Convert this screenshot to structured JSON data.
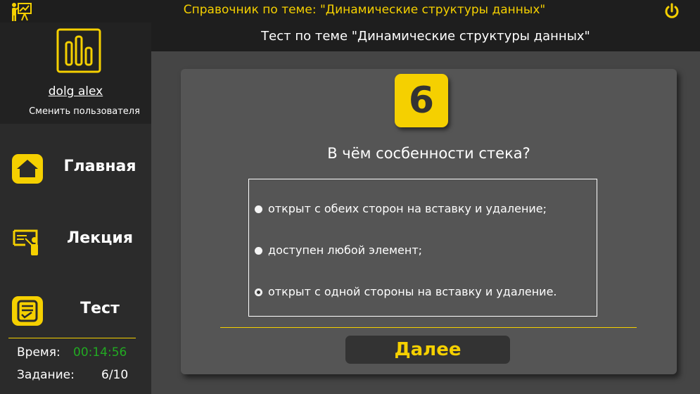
{
  "app": {
    "title": "Справочник по теме: \"Динамические структуры данных\"",
    "icon": "presentation-icon",
    "power_icon": "power-icon"
  },
  "colors": {
    "accent": "#f5d000",
    "timer": "#22aa22",
    "titlebar": "#1e1e1e",
    "sidebar": "#2b2b2b",
    "background": "#454545",
    "card": "#555555"
  },
  "sidebar": {
    "username": "dolg alex",
    "change_user": "Сменить пользователя",
    "profile_icon": "bar-chart-icon",
    "nav": [
      {
        "label": "Главная",
        "icon": "home-icon"
      },
      {
        "label": "Лекция",
        "icon": "lecture-icon"
      },
      {
        "label": "Тест",
        "icon": "test-icon"
      }
    ],
    "time_label": "Время:",
    "time_value": "00:14:56",
    "task_label": "Задание:",
    "task_value": "6/10"
  },
  "header": {
    "title": "Тест по теме \"Динамические структуры данных\""
  },
  "quiz": {
    "number": "6",
    "question": "В чём сосбенности стека?",
    "options": [
      {
        "label": "открыт с обеих сторон на вставку и удаление;",
        "selected": false
      },
      {
        "label": "доступен любой элемент;",
        "selected": false
      },
      {
        "label": "открыт с одной стороны на вставку и удаление.",
        "selected": true
      }
    ],
    "next_label": "Далее"
  }
}
